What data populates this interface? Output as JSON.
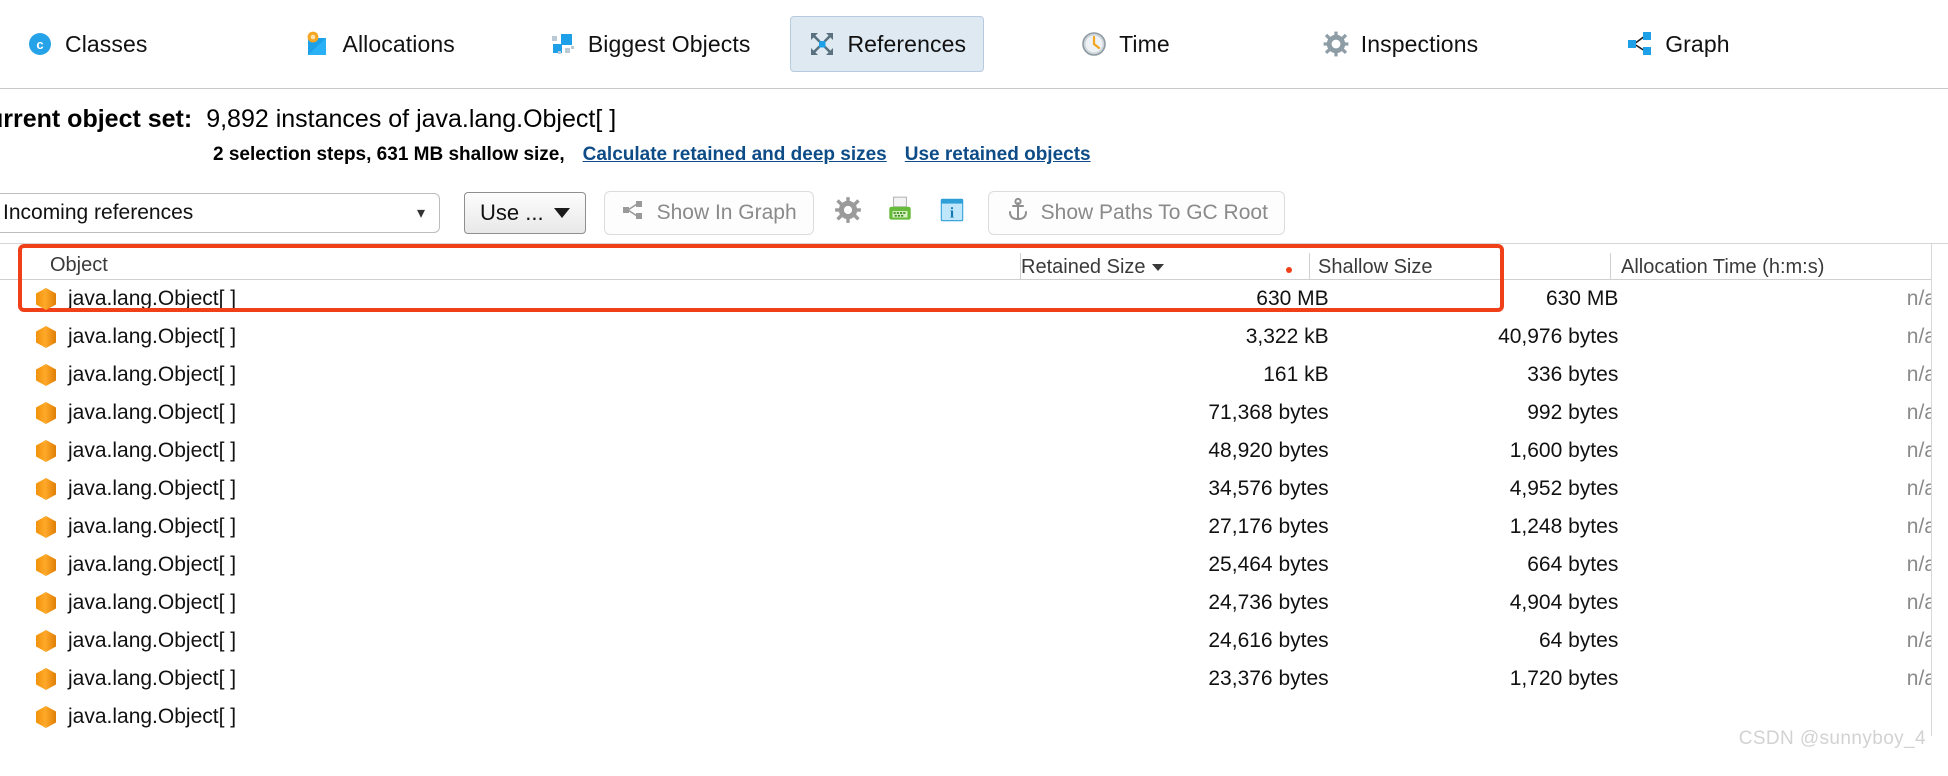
{
  "nav": {
    "items": [
      {
        "label": "Classes",
        "icon": "classes-icon",
        "selected": false
      },
      {
        "label": "Allocations",
        "icon": "allocations-icon",
        "selected": false
      },
      {
        "label": "Biggest Objects",
        "icon": "biggest-objects-icon",
        "selected": false
      },
      {
        "label": "References",
        "icon": "references-icon",
        "selected": true
      },
      {
        "label": "Time",
        "icon": "clock-icon",
        "selected": false
      },
      {
        "label": "Inspections",
        "icon": "gear-icon",
        "selected": false
      },
      {
        "label": "Graph",
        "icon": "graph-icon",
        "selected": false
      }
    ]
  },
  "object_set": {
    "label": "urrent object set:",
    "value": "9,892 instances of java.lang.Object[ ]",
    "selection_info": "2 selection steps, 631 MB shallow size,",
    "link_calculate": "Calculate retained and deep sizes",
    "link_use_retained": "Use retained objects"
  },
  "toolbar": {
    "reference_mode": "Incoming references",
    "reference_mode_chevron": "chevron-down-icon",
    "use_button": "Use ...",
    "show_in_graph": "Show In Graph",
    "gear_icon": "gear-icon",
    "export_icon": "export-icon",
    "info_icon": "info-icon",
    "show_paths": "Show Paths To GC Root"
  },
  "table": {
    "columns": [
      {
        "key": "object",
        "label": "Object"
      },
      {
        "key": "retained",
        "label": "Retained Size",
        "sorted": "desc"
      },
      {
        "key": "shallow",
        "label": "Shallow Size"
      },
      {
        "key": "alloc",
        "label": "Allocation Time (h:m:s)"
      }
    ],
    "rows": [
      {
        "object": "java.lang.Object[ ]",
        "retained": "630 MB",
        "shallow": "630 MB",
        "alloc": "n/a"
      },
      {
        "object": "java.lang.Object[ ]",
        "retained": "3,322 kB",
        "shallow": "40,976 bytes",
        "alloc": "n/a"
      },
      {
        "object": "java.lang.Object[ ]",
        "retained": "161 kB",
        "shallow": "336 bytes",
        "alloc": "n/a"
      },
      {
        "object": "java.lang.Object[ ]",
        "retained": "71,368 bytes",
        "shallow": "992 bytes",
        "alloc": "n/a"
      },
      {
        "object": "java.lang.Object[ ]",
        "retained": "48,920 bytes",
        "shallow": "1,600 bytes",
        "alloc": "n/a"
      },
      {
        "object": "java.lang.Object[ ]",
        "retained": "34,576 bytes",
        "shallow": "4,952 bytes",
        "alloc": "n/a"
      },
      {
        "object": "java.lang.Object[ ]",
        "retained": "27,176 bytes",
        "shallow": "1,248 bytes",
        "alloc": "n/a"
      },
      {
        "object": "java.lang.Object[ ]",
        "retained": "25,464 bytes",
        "shallow": "664 bytes",
        "alloc": "n/a"
      },
      {
        "object": "java.lang.Object[ ]",
        "retained": "24,736 bytes",
        "shallow": "4,904 bytes",
        "alloc": "n/a"
      },
      {
        "object": "java.lang.Object[ ]",
        "retained": "24,616 bytes",
        "shallow": "64 bytes",
        "alloc": "n/a"
      },
      {
        "object": "java.lang.Object[ ]",
        "retained": "23,376 bytes",
        "shallow": "1,720 bytes",
        "alloc": "n/a"
      },
      {
        "object": "java.lang.Object[ ]",
        "retained": "",
        "shallow": "",
        "alloc": ""
      }
    ]
  },
  "annotation": {
    "highlight_color": "#f0401a"
  },
  "watermark": "CSDN @sunnyboy_4"
}
